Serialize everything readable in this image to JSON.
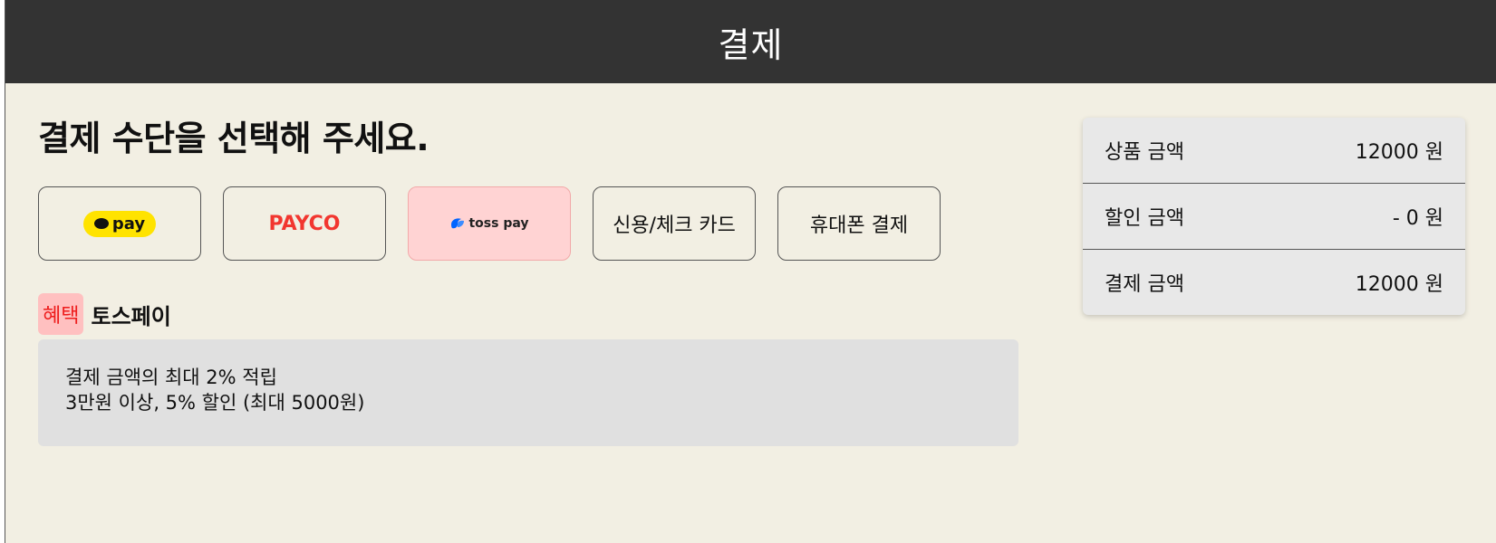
{
  "header": {
    "title": "결제"
  },
  "main": {
    "heading": "결제 수단을 선택해 주세요.",
    "methods": [
      {
        "label": "pay",
        "icon": "kakaopay-logo"
      },
      {
        "label": "PAYCO",
        "icon": "payco-logo"
      },
      {
        "label": "toss pay",
        "icon": "tosspay-logo",
        "selected": true
      },
      {
        "label": "신용/체크 카드"
      },
      {
        "label": "휴대폰 결제"
      }
    ],
    "benefit": {
      "badge": "혜택",
      "title": "토스페이",
      "lines": [
        "결제 금액의 최대 2% 적립",
        "3만원 이상, 5% 할인 (최대 5000원)"
      ]
    }
  },
  "summary": {
    "rows": [
      {
        "label": "상품 금액",
        "value": "12000 원"
      },
      {
        "label": "할인 금액",
        "value": "- 0 원"
      },
      {
        "label": "결제 금액",
        "value": "12000 원"
      }
    ]
  },
  "colors": {
    "header_bg": "#333333",
    "page_bg": "#f2efe3",
    "selected_bg": "#ffd3d3",
    "payco_red": "#f2362f",
    "kakao_yellow": "#ffe300",
    "benefit_badge_text": "#ee1c1c"
  }
}
